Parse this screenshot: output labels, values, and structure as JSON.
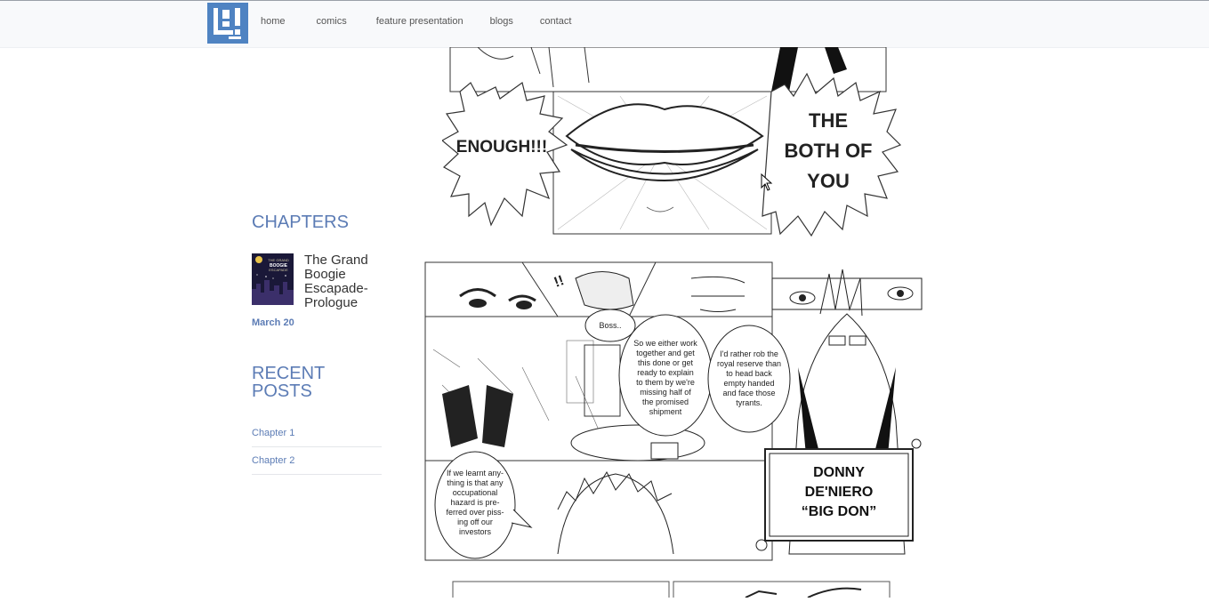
{
  "nav": {
    "items": [
      {
        "label": "home"
      },
      {
        "label": "comics"
      },
      {
        "label": "feature presentation"
      },
      {
        "label": "blogs"
      },
      {
        "label": "contact"
      }
    ]
  },
  "sidebar": {
    "chapters_heading": "CHAPTERS",
    "chapter": {
      "title": "The Grand Boogie Escapade- Prologue",
      "date": "March 20",
      "thumb_text_1": "THE GRAND",
      "thumb_text_2": "BOOGIE",
      "thumb_text_3": "ESCAPADE"
    },
    "recent_heading": "RECENT POSTS",
    "recent_posts": [
      {
        "label": "Chapter 1"
      },
      {
        "label": "Chapter 2"
      }
    ]
  },
  "comic": {
    "top_left_bubble": "ENOUGH!!!",
    "top_right_bubble_1": "THE",
    "top_right_bubble_2": "BOTH OF",
    "top_right_bubble_3": "YOU",
    "exclaim": "!!",
    "boss": "Boss..",
    "speech_1": [
      "So we either work",
      "together and get",
      "this done or get",
      "ready to explain",
      "to them by we're",
      "missing half of",
      "the promised",
      "shipment"
    ],
    "speech_2": [
      "I'd rather rob the",
      "royal reserve than",
      "to head back",
      "empty handed",
      "and face those",
      "tyrants."
    ],
    "speech_3": [
      "If we learnt any-",
      "thing is that any",
      "occupational",
      "hazard is pre-",
      "ferred over piss-",
      "ing off our",
      "investors"
    ],
    "name_card_1": "DONNY",
    "name_card_2": "DE'NIERO",
    "name_card_3": "“BIG DON”"
  }
}
